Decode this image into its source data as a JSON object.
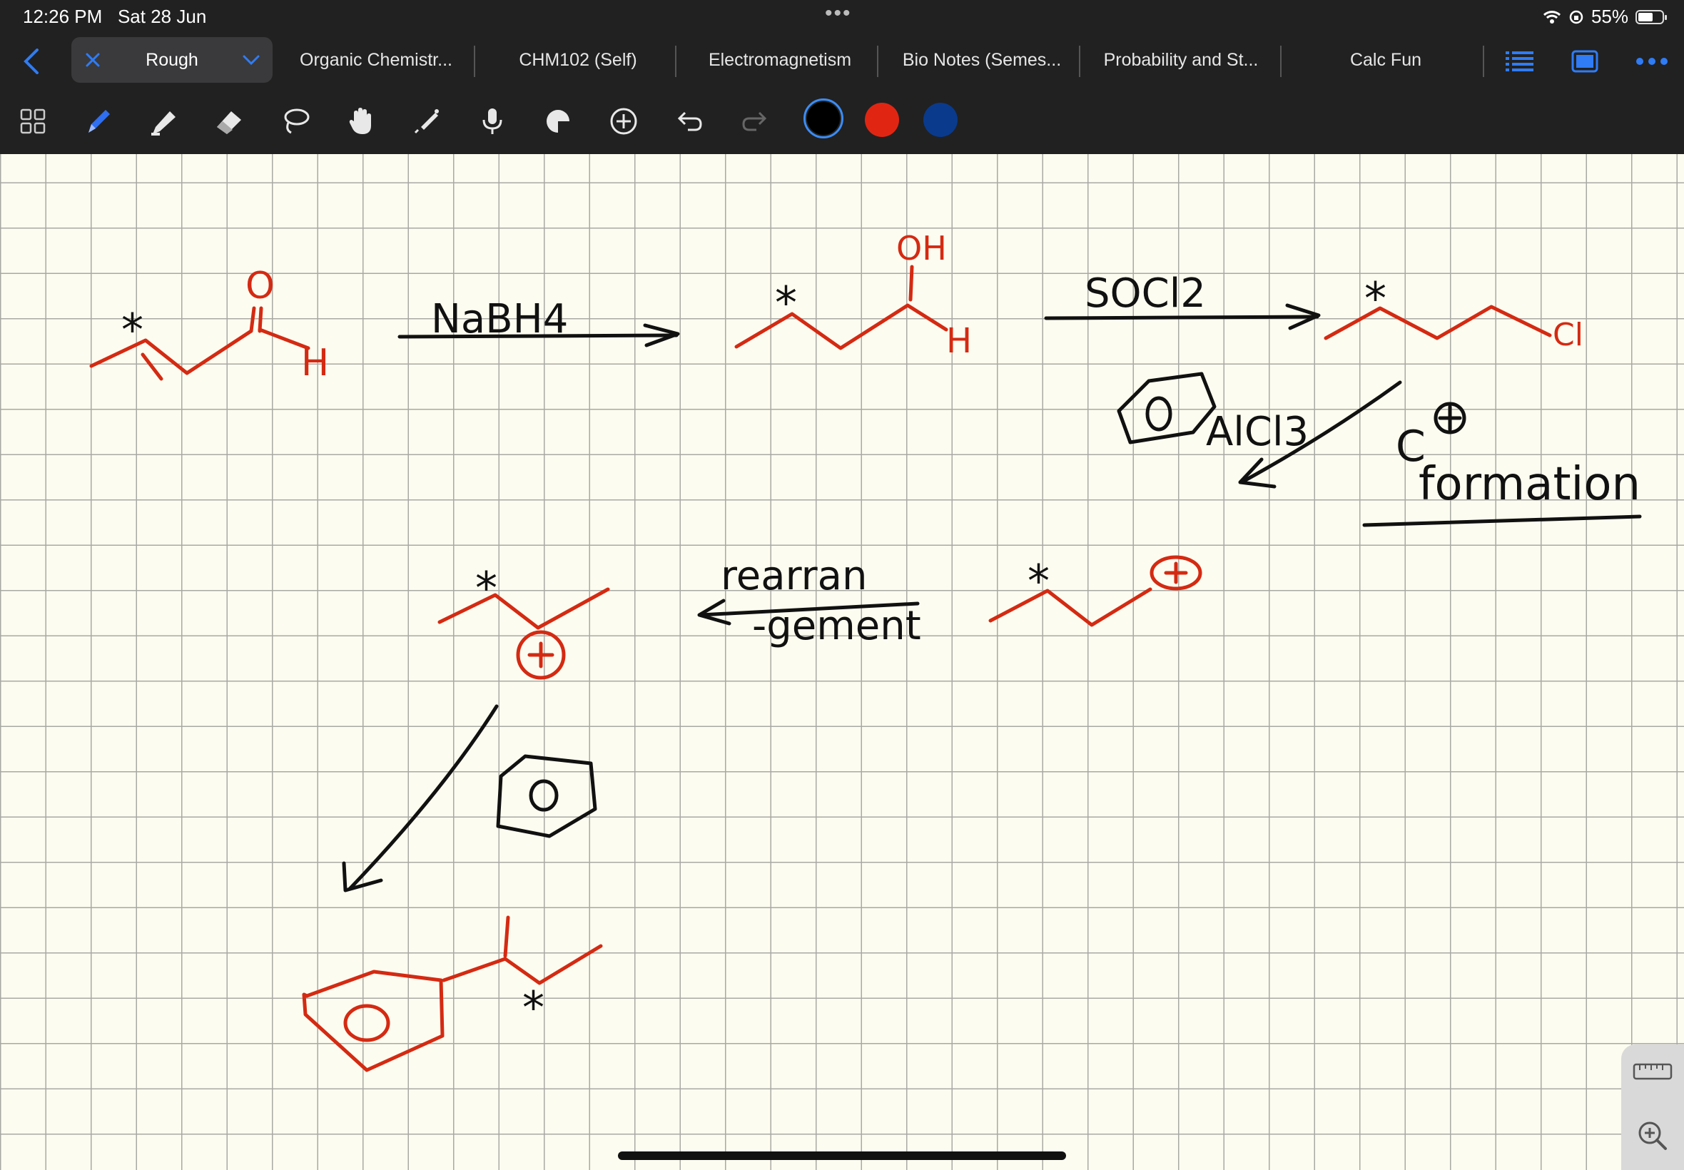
{
  "status_bar": {
    "time": "12:26 PM",
    "date": "Sat 28 Jun",
    "battery": "55%",
    "battery_level": 0.55
  },
  "tabs": {
    "active": "Rough",
    "items": [
      "Organic Chemistr...",
      "CHM102 (Self)",
      "Electromagnetism",
      "Bio Notes (Semes...",
      "Probability and St...",
      "Calc Fun"
    ]
  },
  "toolbar": {
    "tools": [
      "grid-view",
      "pen",
      "highlighter",
      "eraser",
      "lasso",
      "hand",
      "laser-pointer",
      "microphone",
      "shapes",
      "add",
      "undo",
      "redo"
    ],
    "colors": [
      "#000000",
      "#e02612",
      "#0a3a8c"
    ],
    "selected_color": "#000000"
  },
  "canvas": {
    "background": "#fdfcf0",
    "grid": true,
    "ink_colors": {
      "black": "#111111",
      "red": "#d42a12"
    },
    "labels": {
      "oxygen": "O",
      "hydrogen": "H",
      "hydroxyl": "OH",
      "chlorine": "Cl",
      "reagent1": "NaBH4",
      "reagent2": "SOCl2",
      "lewis_acid": "AlCl3",
      "benzene_center": "O",
      "note_cation": "C",
      "note_formation": "formation",
      "rearrangement_top": "rearran",
      "rearrangement_bottom": "-gement",
      "plus": "+",
      "star": "*"
    }
  }
}
